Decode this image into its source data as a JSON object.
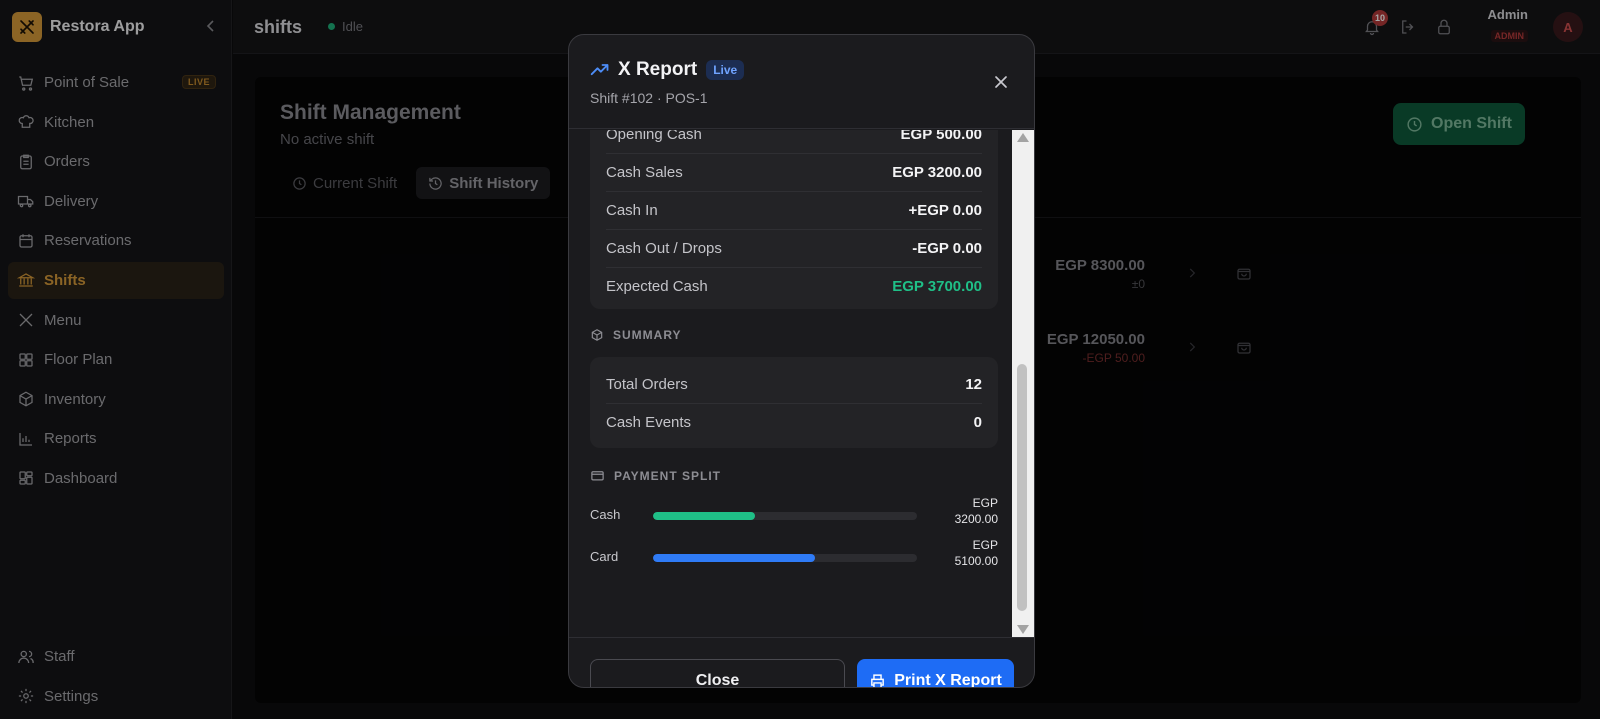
{
  "app": {
    "name": "Restora App"
  },
  "sidebar": {
    "items": [
      {
        "label": "Point of Sale",
        "badge": "LIVE",
        "icon": "cart-icon"
      },
      {
        "label": "Kitchen",
        "icon": "chef-hat-icon"
      },
      {
        "label": "Orders",
        "icon": "clipboard-icon"
      },
      {
        "label": "Delivery",
        "icon": "truck-icon"
      },
      {
        "label": "Reservations",
        "icon": "calendar-icon"
      },
      {
        "label": "Shifts",
        "icon": "bank-icon",
        "active": true
      },
      {
        "label": "Menu",
        "icon": "utensils-icon"
      },
      {
        "label": "Floor Plan",
        "icon": "grid-icon"
      },
      {
        "label": "Inventory",
        "icon": "box-icon"
      },
      {
        "label": "Reports",
        "icon": "bar-chart-icon"
      },
      {
        "label": "Dashboard",
        "icon": "dashboard-icon"
      }
    ],
    "bottom": [
      {
        "label": "Staff",
        "icon": "users-icon"
      },
      {
        "label": "Settings",
        "icon": "gear-icon"
      }
    ]
  },
  "topbar": {
    "title": "shifts",
    "status": "Idle",
    "notifications": "10",
    "user": {
      "name": "Admin",
      "role": "ADMIN",
      "initial": "A"
    }
  },
  "main": {
    "title": "Shift Management",
    "subtitle": "No active shift",
    "open_shift_label": "Open Shift",
    "tabs": [
      {
        "label": "Current Shift"
      },
      {
        "label": "Shift History",
        "active": true
      }
    ],
    "rows": [
      {
        "amount": "EGP 8300.00",
        "delta": "±0"
      },
      {
        "amount": "EGP 12050.00",
        "delta": "-EGP 50.00"
      }
    ]
  },
  "modal": {
    "title": "X Report",
    "badge": "Live",
    "subtitle": "Shift #102 · POS-1",
    "cash": [
      {
        "label": "Opening Cash",
        "value": "EGP 500.00"
      },
      {
        "label": "Cash Sales",
        "value": "EGP 3200.00"
      },
      {
        "label": "Cash In",
        "value": "+EGP 0.00"
      },
      {
        "label": "Cash Out / Drops",
        "value": "-EGP 0.00"
      },
      {
        "label": "Expected Cash",
        "value": "EGP 3700.00"
      }
    ],
    "summary_label": "SUMMARY",
    "summary": [
      {
        "label": "Total Orders",
        "value": "12"
      },
      {
        "label": "Cash Events",
        "value": "0"
      }
    ],
    "payment_label": "PAYMENT SPLIT",
    "payments": [
      {
        "label": "Cash",
        "amount_line1": "EGP",
        "amount_line2": "3200.00",
        "share": 0.3855,
        "color": "#1fbf87"
      },
      {
        "label": "Card",
        "amount_line1": "EGP",
        "amount_line2": "5100.00",
        "share": 0.6145,
        "color": "#2f7bf6"
      }
    ],
    "close_label": "Close",
    "print_label": "Print X Report"
  }
}
